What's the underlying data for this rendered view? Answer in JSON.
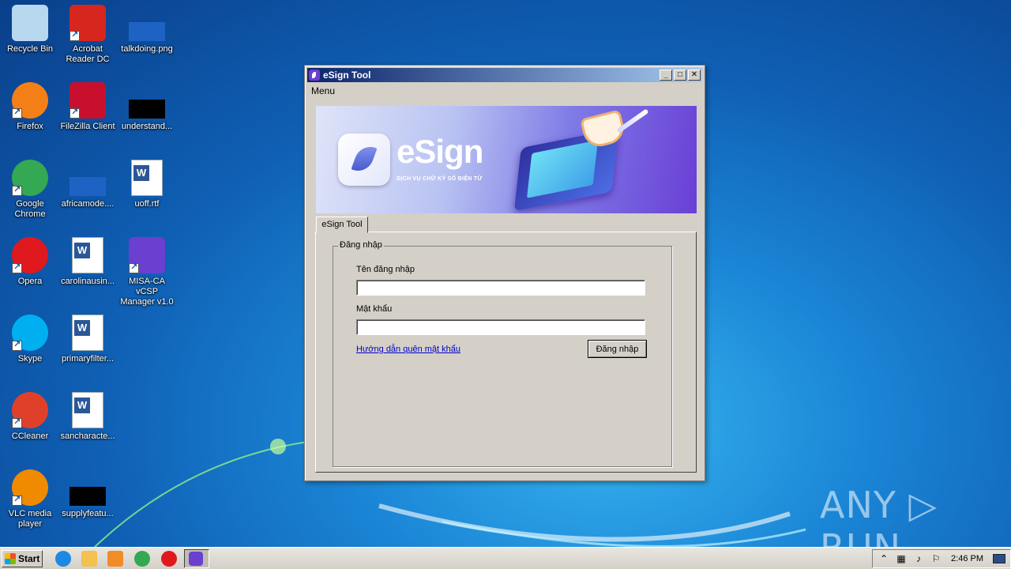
{
  "desktop": {
    "icons": [
      {
        "label": "Recycle Bin",
        "icon": "recycle-bin-icon",
        "color": "#b8d8f0"
      },
      {
        "label": "Acrobat\nReader DC",
        "icon": "acrobat-icon",
        "color": "#d7261e"
      },
      {
        "label": "talkdoing.png",
        "icon": "image-file-icon",
        "color": "#1e63c4"
      },
      {
        "label": "Firefox",
        "icon": "firefox-icon",
        "color": "#f57f17"
      },
      {
        "label": "FileZilla Client",
        "icon": "filezilla-icon",
        "color": "#c8102e"
      },
      {
        "label": "understand...",
        "icon": "file-icon",
        "color": "#000000"
      },
      {
        "label": "Google\nChrome",
        "icon": "chrome-icon",
        "color": "#34a853"
      },
      {
        "label": "africamode....",
        "icon": "image-file-icon",
        "color": "#1e63c4"
      },
      {
        "label": "uoff.rtf",
        "icon": "word-document-icon",
        "color": "#2b5797"
      },
      {
        "label": "Opera",
        "icon": "opera-icon",
        "color": "#e0191f"
      },
      {
        "label": "carolinausin...",
        "icon": "word-document-icon",
        "color": "#2b5797"
      },
      {
        "label": "MISA-CA vCSP\nManager v1.0",
        "icon": "misa-ca-icon",
        "color": "#6b3fd0"
      },
      {
        "label": "Skype",
        "icon": "skype-icon",
        "color": "#00aff0"
      },
      {
        "label": "primaryfilter...",
        "icon": "word-document-icon",
        "color": "#2b5797"
      },
      {
        "label": "CCleaner",
        "icon": "ccleaner-icon",
        "color": "#e0402a"
      },
      {
        "label": "sancharacte...",
        "icon": "word-document-icon",
        "color": "#2b5797"
      },
      {
        "label": "VLC media\nplayer",
        "icon": "vlc-icon",
        "color": "#f08a00"
      },
      {
        "label": "supplyfeatu...",
        "icon": "file-icon",
        "color": "#000000"
      }
    ]
  },
  "window": {
    "title": "eSign Tool",
    "menu": [
      "Menu"
    ],
    "banner": {
      "brand": "eSign",
      "tagline": "DỊCH VỤ CHỮ KÝ SỐ ĐIỆN TỬ"
    },
    "tab_label": "eSign Tool",
    "group_title": "Đăng nhập",
    "username_label": "Tên đăng nhập",
    "username_value": "",
    "password_label": "Mật khẩu",
    "password_value": "",
    "forgot_link": "Hướng dẫn quên mật khẩu",
    "login_button": "Đăng nhập",
    "controls": {
      "minimize": "_",
      "maximize": "□",
      "close": "✕"
    }
  },
  "watermark": "ANY ▷ RUN",
  "taskbar": {
    "start_label": "Start",
    "pinned": [
      {
        "icon": "internet-explorer-icon",
        "color": "#1e88e5"
      },
      {
        "icon": "file-explorer-icon",
        "color": "#f2c14e"
      },
      {
        "icon": "media-player-icon",
        "color": "#f28c28"
      },
      {
        "icon": "chrome-icon",
        "color": "#34a853"
      },
      {
        "icon": "opera-icon",
        "color": "#e0191f"
      },
      {
        "icon": "esign-tool-icon",
        "color": "#6b3fd0"
      }
    ],
    "clock": "2:46 PM"
  }
}
